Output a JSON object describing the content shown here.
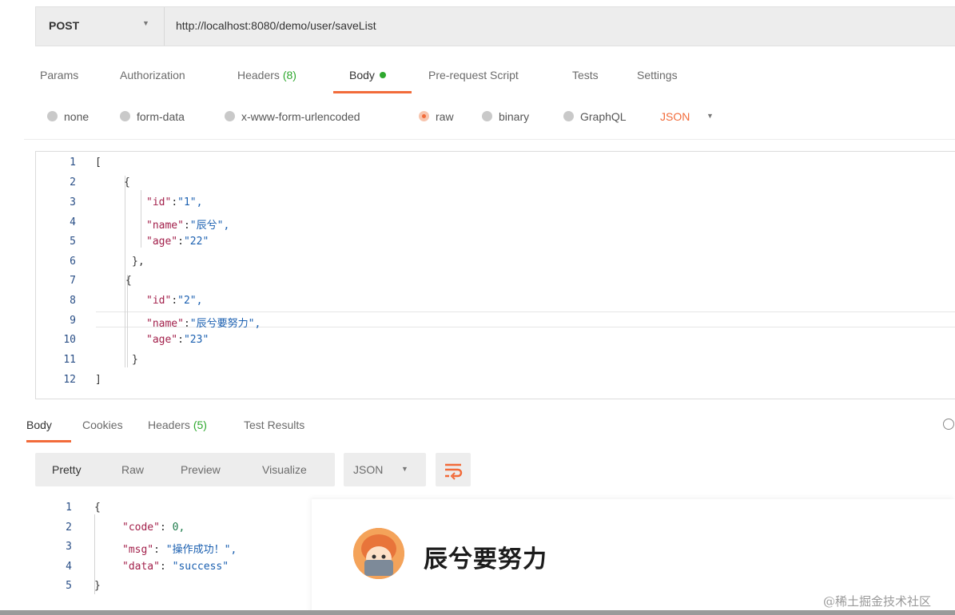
{
  "request": {
    "method": "POST",
    "url": "http://localhost:8080/demo/user/saveList"
  },
  "request_tabs": [
    {
      "label": "Params"
    },
    {
      "label": "Authorization"
    },
    {
      "label": "Headers",
      "count": "(8)"
    },
    {
      "label": "Body"
    },
    {
      "label": "Pre-request Script"
    },
    {
      "label": "Tests"
    },
    {
      "label": "Settings"
    }
  ],
  "body_types": [
    "none",
    "form-data",
    "x-www-form-urlencoded",
    "raw",
    "binary",
    "GraphQL"
  ],
  "body_format": "JSON",
  "request_body": {
    "line_numbers": [
      "1",
      "2",
      "3",
      "4",
      "5",
      "6",
      "7",
      "8",
      "9",
      "10",
      "11",
      "12"
    ],
    "lines": [
      "[",
      "{",
      "\"id\":\"1\",",
      "\"name\":\"辰兮\",",
      "\"age\":\"22\"",
      "},",
      "{",
      "\"id\":\"2\",",
      "\"name\":\"辰兮要努力\",",
      "\"age\":\"23\"",
      "}",
      "]"
    ]
  },
  "response_tabs": [
    {
      "label": "Body"
    },
    {
      "label": "Cookies"
    },
    {
      "label": "Headers",
      "count": "(5)"
    },
    {
      "label": "Test Results"
    }
  ],
  "response_views": [
    "Pretty",
    "Raw",
    "Preview",
    "Visualize"
  ],
  "response_format": "JSON",
  "response_body": {
    "line_numbers": [
      "1",
      "2",
      "3",
      "4",
      "5"
    ],
    "lines": [
      "{",
      "\"code\": 0,",
      "\"msg\": \"操作成功！\",",
      "\"data\": \"success\"",
      "}"
    ]
  },
  "overlay": {
    "title": "辰兮要努力",
    "watermark": "@稀土掘金技术社区"
  },
  "colors": {
    "accent": "#f26b3a",
    "green": "#2ea82e"
  }
}
